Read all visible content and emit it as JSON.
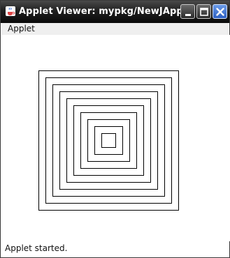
{
  "window": {
    "title": "Applet Viewer: mypkg/NewJApple...",
    "app_icon": "java-coffee-icon",
    "controls": [
      "minimize-icon",
      "maximize-icon",
      "close-icon"
    ]
  },
  "menubar": {
    "items": [
      {
        "label": "Applet"
      }
    ]
  },
  "drawing": {
    "shape": "nested-squares",
    "square_count": 10,
    "stroke_color": "#000000"
  },
  "status": {
    "text": "Applet started."
  },
  "colors": {
    "titlebar": "#1f1f1f",
    "close_button": "#2c5fc4",
    "menubar": "#efefef"
  }
}
